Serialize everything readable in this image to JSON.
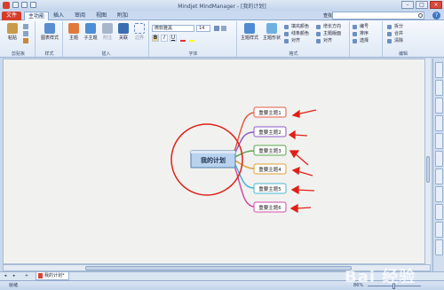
{
  "window": {
    "title": "Mindjet MindManager - [我的计划]",
    "controls": [
      "–",
      "□",
      "×"
    ]
  },
  "tabs": {
    "file": "文件",
    "items": [
      "主功能",
      "插入",
      "审阅",
      "视图",
      "附加"
    ],
    "active_index": 0,
    "search_label": "查找:"
  },
  "ribbon": {
    "clipboard": {
      "paste": "粘贴",
      "label": "剪贴板"
    },
    "style": {
      "button": "图表样式",
      "label": "样式"
    },
    "insert": {
      "topic": "主题",
      "subtopic": "子主题",
      "callout": "附注",
      "relation": "关联",
      "boundary": "边界",
      "label": "插入"
    },
    "font": {
      "family": "微软雅黑",
      "size": "14",
      "bold": "B",
      "italic": "I",
      "underline": "U",
      "label": "字体"
    },
    "format": {
      "topic_style": "主题样式",
      "topic_shape": "主题形状",
      "fill_color": "填充颜色",
      "line_color": "线条颜色",
      "align": "对齐",
      "grow_direction": "增长方向",
      "layout": "主题版面",
      "arrange": "对齐",
      "label": "格式"
    },
    "number": {
      "numbering": "编号",
      "sort": "排序",
      "select": "选择",
      "label": ""
    },
    "edit": {
      "split": "拆分",
      "merge": "合并",
      "clear": "清除",
      "label": "编辑"
    }
  },
  "mindmap": {
    "central_topic": "我的计划",
    "main_topics": [
      "重要主题1",
      "重要主题2",
      "重要主题3",
      "重要主题4",
      "重要主题5",
      "重要主题6"
    ],
    "topic_colors": [
      "#e45a46",
      "#8b5ac7",
      "#5aa54d",
      "#e0a033",
      "#47b6d6",
      "#d64aa6"
    ],
    "annotation_color": "#e02018"
  },
  "sheet_tab": {
    "label": "我的计划*"
  },
  "status": {
    "left": "就绪",
    "zoom": "86%"
  },
  "watermark": "Bai 经验"
}
